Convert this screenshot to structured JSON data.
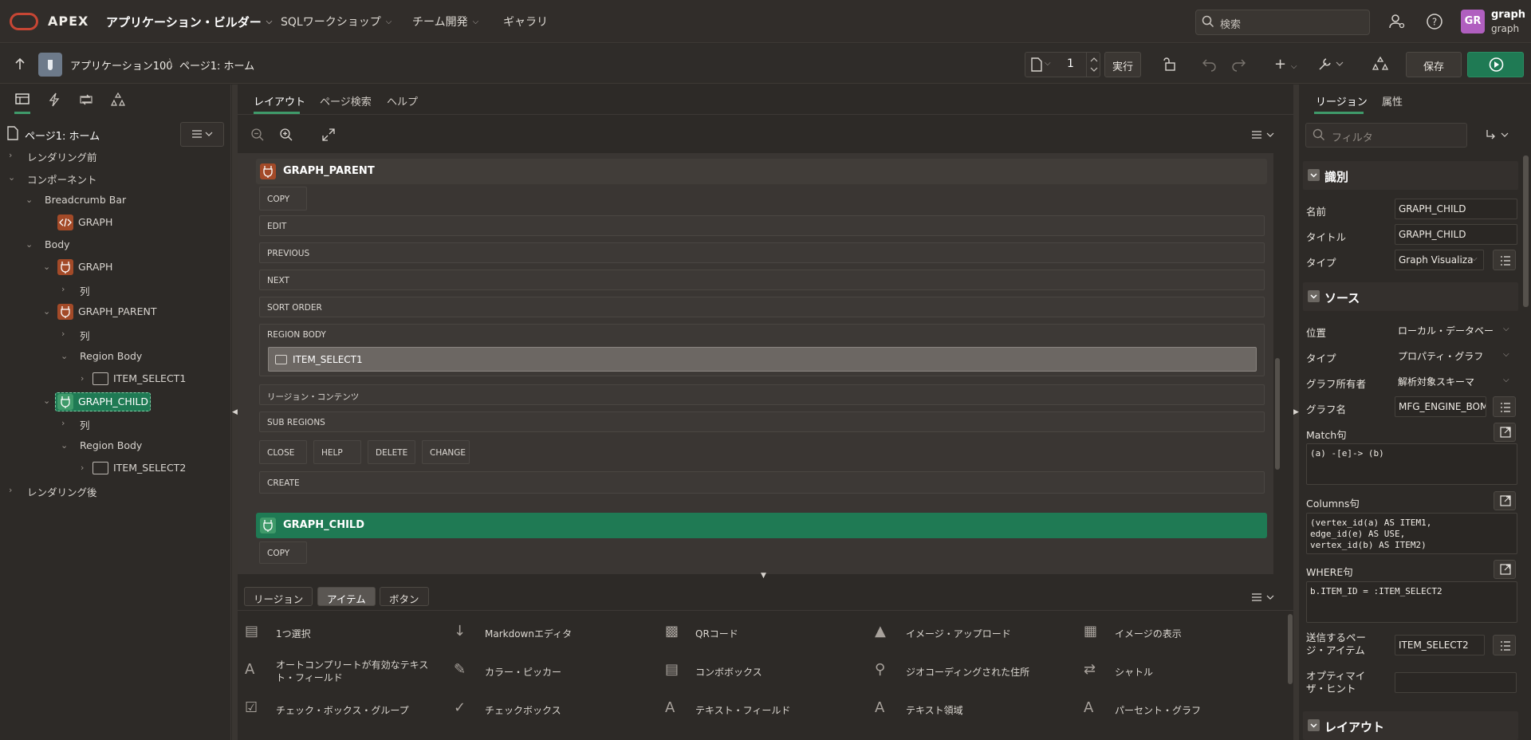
{
  "header": {
    "brand": "APEX",
    "nav": [
      {
        "label": "アプリケーション・ビルダー"
      },
      {
        "label": "SQLワークショップ"
      },
      {
        "label": "チーム開発"
      },
      {
        "label": "ギャラリ"
      }
    ],
    "search_placeholder": "検索",
    "avatar_initials": "GR",
    "user_name": "graph",
    "user_workspace": "graph"
  },
  "toolbar": {
    "app_crumb": "アプリケーション100",
    "separator": "\\",
    "page_crumb": "ページ1: ホーム",
    "page_number": "1",
    "run_label": "実行",
    "save_label": "保存"
  },
  "left": {
    "page_title": "ページ1: ホーム",
    "tree": {
      "before_render": "レンダリング前",
      "components": "コンポーネント",
      "breadcrumb_bar": "Breadcrumb Bar",
      "graph_breadcrumb": "GRAPH",
      "body": "Body",
      "graph_region": "GRAPH",
      "columns1": "列",
      "graph_parent": "GRAPH_PARENT",
      "columns2": "列",
      "region_body1": "Region Body",
      "item_select1": "ITEM_SELECT1",
      "graph_child": "GRAPH_CHILD",
      "columns3": "列",
      "region_body2": "Region Body",
      "item_select2": "ITEM_SELECT2",
      "after_render": "レンダリング後"
    }
  },
  "center": {
    "tabs": [
      "レイアウト",
      "ページ検索",
      "ヘルプ"
    ],
    "parent_region": "GRAPH_PARENT",
    "parent_slots": {
      "copy": "COPY",
      "edit": "EDIT",
      "previous": "PREVIOUS",
      "next": "NEXT",
      "sort_order": "SORT ORDER",
      "region_body": "REGION BODY",
      "item": "ITEM_SELECT1",
      "region_contents": "リージョン・コンテンツ",
      "sub_regions": "SUB REGIONS",
      "close": "CLOSE",
      "help": "HELP",
      "delete": "DELETE",
      "change": "CHANGE",
      "create": "CREATE"
    },
    "child_region": "GRAPH_CHILD",
    "child_copy": "COPY"
  },
  "gallery": {
    "tabs": [
      "リージョン",
      "アイテム",
      "ボタン"
    ],
    "items": [
      "1つ選択",
      "Markdownエディタ",
      "QRコード",
      "イメージ・アップロード",
      "イメージの表示",
      "オートコンプリートが有効なテキスト・フィールド",
      "カラー・ピッカー",
      "コンボボックス",
      "ジオコーディングされた住所",
      "シャトル",
      "チェック・ボックス・グループ",
      "チェックボックス",
      "テキスト・フィールド",
      "テキスト領域",
      "パーセント・グラフ"
    ]
  },
  "right": {
    "tabs": [
      "リージョン",
      "属性"
    ],
    "filter_placeholder": "フィルタ",
    "identification": {
      "title": "識別",
      "name_label": "名前",
      "name_value": "GRAPH_CHILD",
      "title_label": "タイトル",
      "title_value": "GRAPH_CHILD",
      "type_label": "タイプ",
      "type_value": "Graph Visualiza"
    },
    "source": {
      "title": "ソース",
      "location_label": "位置",
      "location_value": "ローカル・データベー",
      "type_label": "タイプ",
      "type_value": "プロパティ・グラフ",
      "owner_label": "グラフ所有者",
      "owner_value": "解析対象スキーマ",
      "graph_name_label": "グラフ名",
      "graph_name_value": "MFG_ENGINE_BOM",
      "match_label": "Match句",
      "match_value": "(a) -[e]-> (b)",
      "columns_label": "Columns句",
      "columns_value": "(vertex_id(a) AS ITEM1,\nedge_id(e) AS USE,\nvertex_id(b) AS ITEM2)",
      "where_label": "WHERE句",
      "where_value": "b.ITEM_ID = :ITEM_SELECT2",
      "submit_label": "送信するページ・アイテム",
      "submit_value": "ITEM_SELECT2",
      "optimizer_label": "オプティマイザ・ヒント",
      "optimizer_value": ""
    },
    "layout_title": "レイアウト"
  },
  "colors": {
    "accent_green": "#1f7a54",
    "region_icon": "#a34a28",
    "oracle_red": "#c74634"
  }
}
